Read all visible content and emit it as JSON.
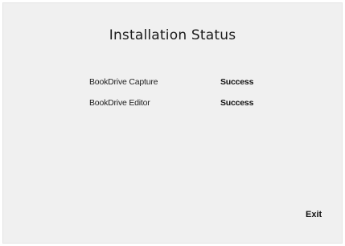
{
  "dialog": {
    "title": "Installation Status",
    "items": [
      {
        "name": "BookDrive Capture",
        "status": "Success"
      },
      {
        "name": "BookDrive Editor",
        "status": "Success"
      }
    ],
    "exit_label": "Exit"
  }
}
